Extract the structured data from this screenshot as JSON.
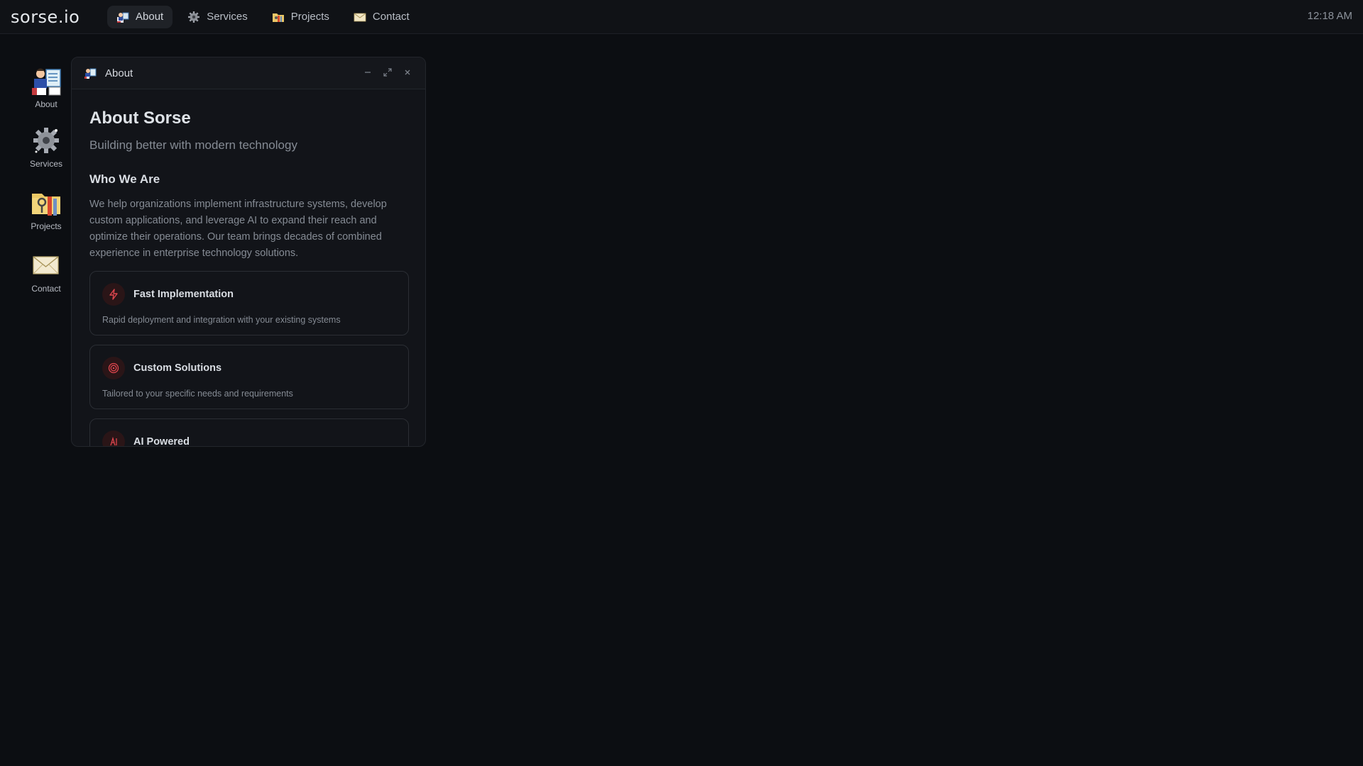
{
  "topbar": {
    "logo": "sorse.io",
    "nav": [
      {
        "label": "About",
        "icon": "about-icon",
        "active": true
      },
      {
        "label": "Services",
        "icon": "services-gear-icon",
        "active": false
      },
      {
        "label": "Projects",
        "icon": "projects-folder-icon",
        "active": false
      },
      {
        "label": "Contact",
        "icon": "contact-envelope-icon",
        "active": false
      }
    ],
    "clock": "12:18 AM"
  },
  "desktop": {
    "icons": [
      {
        "label": "About",
        "icon": "about-icon"
      },
      {
        "label": "Services",
        "icon": "services-gear-icon"
      },
      {
        "label": "Projects",
        "icon": "projects-folder-icon"
      },
      {
        "label": "Contact",
        "icon": "contact-envelope-icon"
      }
    ]
  },
  "window": {
    "title": "About",
    "controls": [
      "minimize-icon",
      "maximize-icon",
      "close-icon"
    ],
    "heading": "About Sorse",
    "subtitle": "Building better with modern technology",
    "section_title": "Who We Are",
    "paragraph": "We help organizations implement infrastructure systems, develop custom applications, and leverage AI to expand their reach and optimize their operations. Our team brings decades of combined experience in enterprise technology solutions.",
    "cards": [
      {
        "title": "Fast Implementation",
        "desc": "Rapid deployment and integration with your existing systems",
        "icon": "lightning-icon"
      },
      {
        "title": "Custom Solutions",
        "desc": "Tailored to your specific needs and requirements",
        "icon": "target-icon"
      },
      {
        "title": "AI Powered",
        "desc": "",
        "icon": "ai-icon"
      }
    ]
  },
  "colors": {
    "background": "#0c0e12",
    "accent": "#e0464e"
  }
}
